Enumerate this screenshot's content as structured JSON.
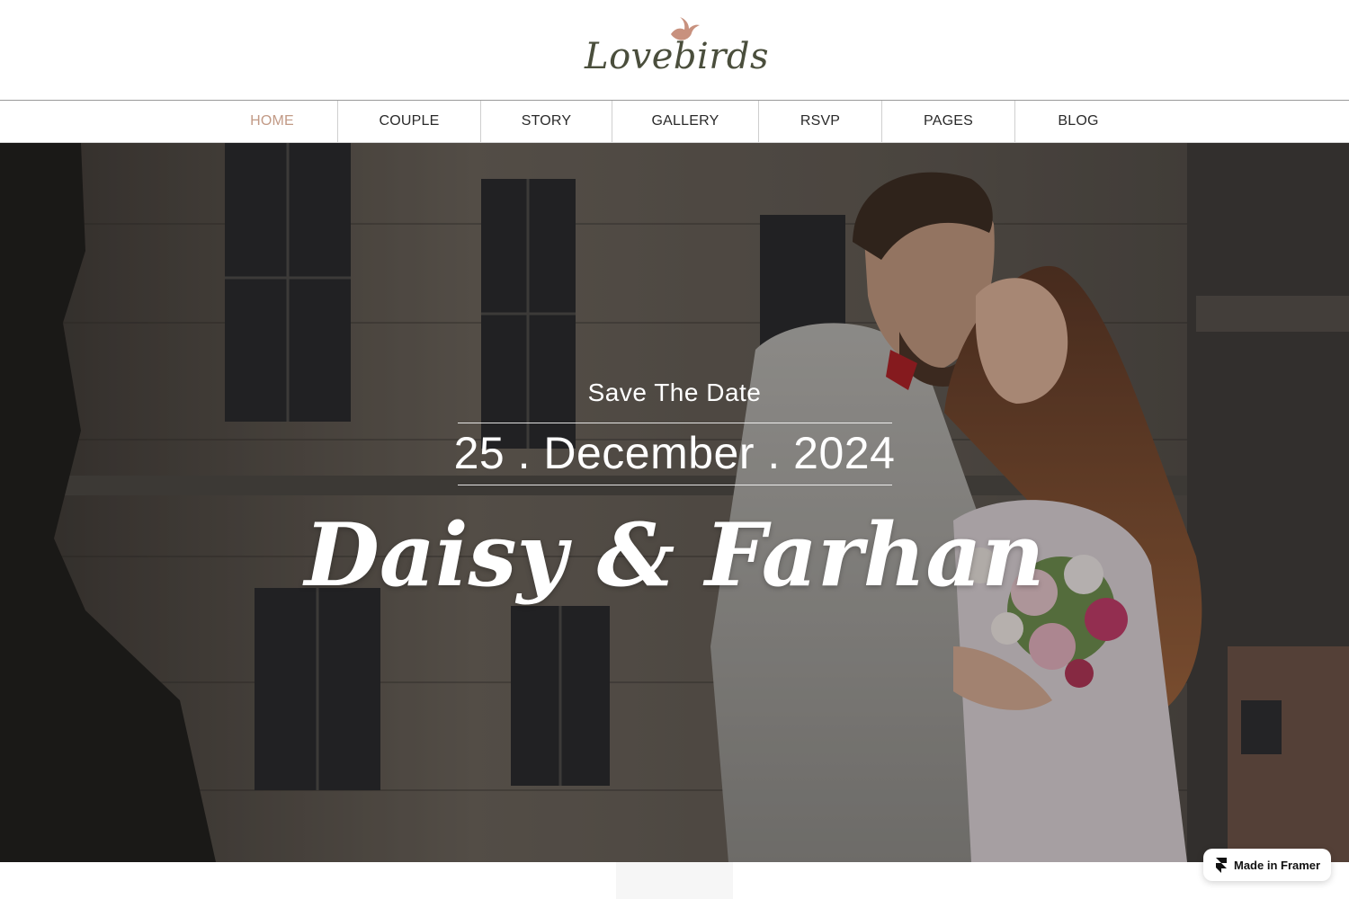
{
  "brand": {
    "logo_text": "Lovebirds",
    "logo_icon": "bird-icon",
    "accent_color": "#c29a86"
  },
  "nav": {
    "items": [
      {
        "label": "HOME",
        "active": true
      },
      {
        "label": "COUPLE",
        "active": false
      },
      {
        "label": "STORY",
        "active": false
      },
      {
        "label": "GALLERY",
        "active": false
      },
      {
        "label": "RSVP",
        "active": false
      },
      {
        "label": "PAGES",
        "active": false
      },
      {
        "label": "BLOG",
        "active": false
      }
    ]
  },
  "hero": {
    "eyebrow": "Save The Date",
    "date": "25 . December . 2024",
    "names": "Daisy & Farhan"
  },
  "badge": {
    "label": "Made in Framer",
    "icon": "framer-icon"
  }
}
